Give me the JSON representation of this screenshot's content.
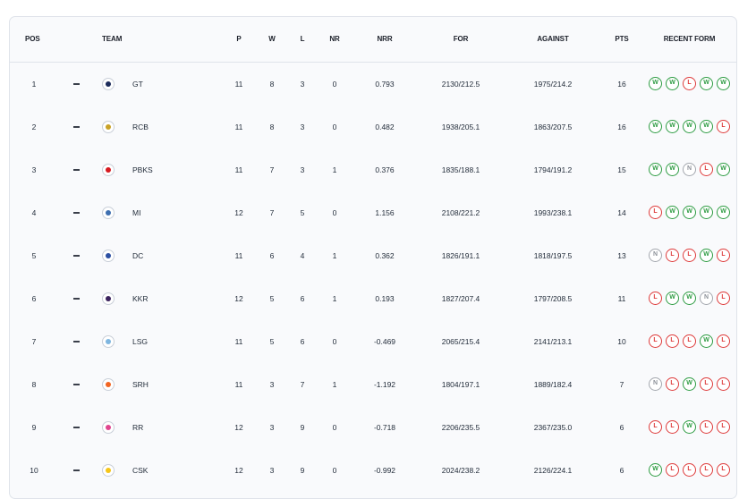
{
  "headers": {
    "pos": "POS",
    "team": "TEAM",
    "p": "P",
    "w": "W",
    "l": "L",
    "nr": "NR",
    "nrr": "NRR",
    "for": "FOR",
    "against": "AGAINST",
    "pts": "PTS",
    "form": "RECENT FORM"
  },
  "colors": {
    "win": "#2e9c43",
    "loss": "#de3b3b",
    "no_result": "#a3a7ae",
    "card_bg": "#f9fafc"
  },
  "rows": [
    {
      "pos": "1",
      "team": "GT",
      "logo_color": "#1c2c5b",
      "p": "11",
      "w": "8",
      "l": "3",
      "nr": "0",
      "nrr": "0.793",
      "for": "2130/212.5",
      "against": "1975/214.2",
      "pts": "16",
      "form": [
        "W",
        "W",
        "L",
        "W",
        "W"
      ]
    },
    {
      "pos": "2",
      "team": "RCB",
      "logo_color": "#c9a227",
      "p": "11",
      "w": "8",
      "l": "3",
      "nr": "0",
      "nrr": "0.482",
      "for": "1938/205.1",
      "against": "1863/207.5",
      "pts": "16",
      "form": [
        "W",
        "W",
        "W",
        "W",
        "L"
      ]
    },
    {
      "pos": "3",
      "team": "PBKS",
      "logo_color": "#d71920",
      "p": "11",
      "w": "7",
      "l": "3",
      "nr": "1",
      "nrr": "0.376",
      "for": "1835/188.1",
      "against": "1794/191.2",
      "pts": "15",
      "form": [
        "W",
        "W",
        "N",
        "L",
        "W"
      ]
    },
    {
      "pos": "4",
      "team": "MI",
      "logo_color": "#3e6fb0",
      "p": "12",
      "w": "7",
      "l": "5",
      "nr": "0",
      "nrr": "1.156",
      "for": "2108/221.2",
      "against": "1993/238.1",
      "pts": "14",
      "form": [
        "L",
        "W",
        "W",
        "W",
        "W"
      ]
    },
    {
      "pos": "5",
      "team": "DC",
      "logo_color": "#2b4fa2",
      "p": "11",
      "w": "6",
      "l": "4",
      "nr": "1",
      "nrr": "0.362",
      "for": "1826/191.1",
      "against": "1818/197.5",
      "pts": "13",
      "form": [
        "N",
        "L",
        "L",
        "W",
        "L"
      ]
    },
    {
      "pos": "6",
      "team": "KKR",
      "logo_color": "#3a225d",
      "p": "12",
      "w": "5",
      "l": "6",
      "nr": "1",
      "nrr": "0.193",
      "for": "1827/207.4",
      "against": "1797/208.5",
      "pts": "11",
      "form": [
        "L",
        "W",
        "W",
        "N",
        "L"
      ]
    },
    {
      "pos": "7",
      "team": "LSG",
      "logo_color": "#7fb6e0",
      "p": "11",
      "w": "5",
      "l": "6",
      "nr": "0",
      "nrr": "-0.469",
      "for": "2065/215.4",
      "against": "2141/213.1",
      "pts": "10",
      "form": [
        "L",
        "L",
        "L",
        "W",
        "L"
      ]
    },
    {
      "pos": "8",
      "team": "SRH",
      "logo_color": "#f26522",
      "p": "11",
      "w": "3",
      "l": "7",
      "nr": "1",
      "nrr": "-1.192",
      "for": "1804/197.1",
      "against": "1889/182.4",
      "pts": "7",
      "form": [
        "N",
        "L",
        "W",
        "L",
        "L"
      ]
    },
    {
      "pos": "9",
      "team": "RR",
      "logo_color": "#e0458f",
      "p": "12",
      "w": "3",
      "l": "9",
      "nr": "0",
      "nrr": "-0.718",
      "for": "2206/235.5",
      "against": "2367/235.0",
      "pts": "6",
      "form": [
        "L",
        "L",
        "W",
        "L",
        "L"
      ]
    },
    {
      "pos": "10",
      "team": "CSK",
      "logo_color": "#f5c518",
      "p": "12",
      "w": "3",
      "l": "9",
      "nr": "0",
      "nrr": "-0.992",
      "for": "2024/238.2",
      "against": "2126/224.1",
      "pts": "6",
      "form": [
        "W",
        "L",
        "L",
        "L",
        "L"
      ]
    }
  ]
}
